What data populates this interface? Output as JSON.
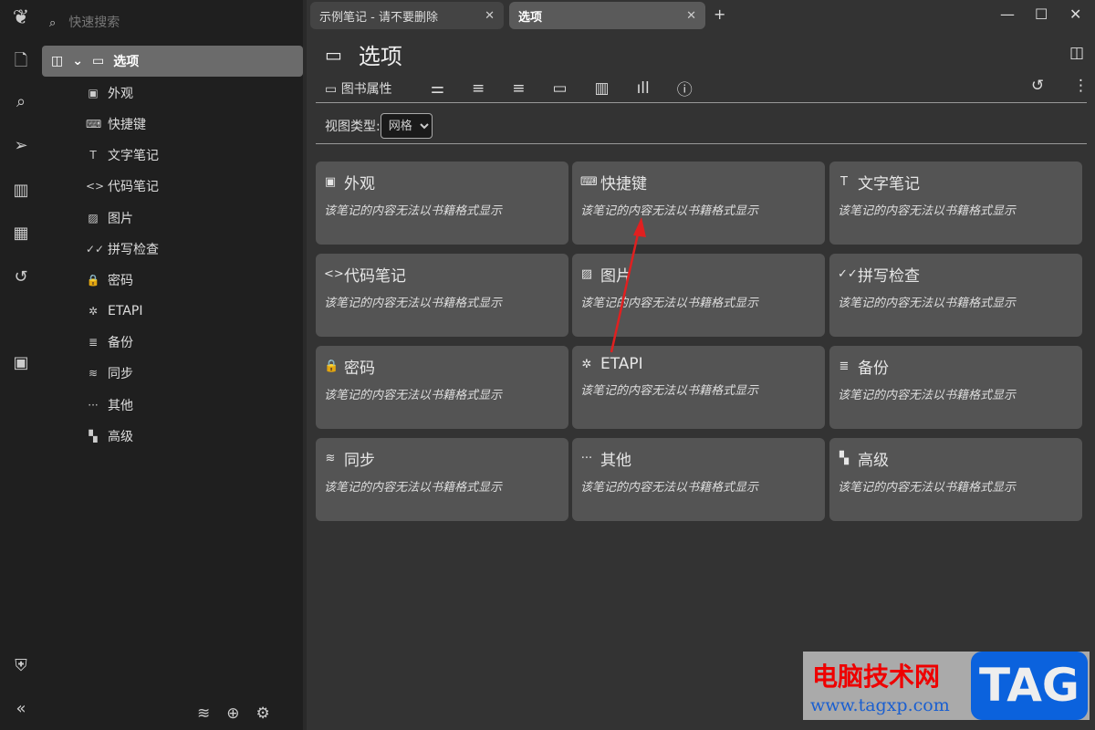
{
  "search": {
    "placeholder": "快速搜索",
    "icon": "search-icon"
  },
  "launcher": [
    "note-icon",
    "search-icon",
    "send-icon",
    "map-icon",
    "calendar-icon",
    "history-icon",
    "calendar-star-icon",
    "shield-icon",
    "collapse-icon"
  ],
  "tree": {
    "root": "选项",
    "items": [
      {
        "label": "外观",
        "icon": "▣"
      },
      {
        "label": "快捷键",
        "icon": "⌨"
      },
      {
        "label": "文字笔记",
        "icon": "T"
      },
      {
        "label": "代码笔记",
        "icon": "<>"
      },
      {
        "label": "图片",
        "icon": "▨"
      },
      {
        "label": "拼写检查",
        "icon": "✓✓"
      },
      {
        "label": "密码",
        "icon": "🔒"
      },
      {
        "label": "ETAPI",
        "icon": "✲"
      },
      {
        "label": "备份",
        "icon": "≣"
      },
      {
        "label": "同步",
        "icon": "≋"
      },
      {
        "label": "其他",
        "icon": "···"
      },
      {
        "label": "高级",
        "icon": "▚"
      }
    ]
  },
  "tabs": [
    {
      "label": "示例笔记 - 请不要删除",
      "active": false
    },
    {
      "label": "选项",
      "active": true
    }
  ],
  "note": {
    "title": "选项",
    "ribbon_label": "图书属性"
  },
  "view_type": {
    "label": "视图类型:",
    "value": "网格"
  },
  "cards": [
    {
      "title": "外观",
      "icon": "▣"
    },
    {
      "title": "快捷键",
      "icon": "⌨"
    },
    {
      "title": "文字笔记",
      "icon": "T"
    },
    {
      "title": "代码笔记",
      "icon": "<>"
    },
    {
      "title": "图片",
      "icon": "▨"
    },
    {
      "title": "拼写检查",
      "icon": "✓✓"
    },
    {
      "title": "密码",
      "icon": "🔒"
    },
    {
      "title": "ETAPI",
      "icon": "✲"
    },
    {
      "title": "备份",
      "icon": "≣"
    },
    {
      "title": "同步",
      "icon": "≋"
    },
    {
      "title": "其他",
      "icon": "···"
    },
    {
      "title": "高级",
      "icon": "▚"
    }
  ],
  "card_desc": "该笔记的内容无法以书籍格式显示",
  "watermark": {
    "text": "电脑技术网",
    "url": "www.tagxp.com",
    "logo": "TAG"
  },
  "colors": {
    "arrow": "#e02020",
    "selected": "#6b6b6b",
    "card": "#545454"
  }
}
